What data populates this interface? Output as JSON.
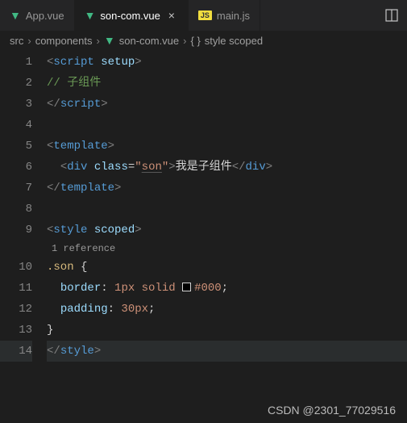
{
  "tabs": [
    {
      "icon": "vue",
      "label": "App.vue",
      "active": false
    },
    {
      "icon": "vue",
      "label": "son-com.vue",
      "active": true
    },
    {
      "icon": "js",
      "label": "main.js",
      "active": false
    }
  ],
  "breadcrumbs": {
    "seg1": "src",
    "seg2": "components",
    "seg3": "son-com.vue",
    "seg4": "style scoped",
    "brackets": "{ }"
  },
  "lines": [
    "1",
    "2",
    "3",
    "4",
    "5",
    "6",
    "7",
    "8",
    "9",
    "10",
    "11",
    "12",
    "13",
    "14"
  ],
  "code": {
    "l1": {
      "open": "<",
      "tag": "script",
      "attr": "setup",
      "close": ">"
    },
    "l2": {
      "comment": "// 子组件"
    },
    "l3": {
      "open": "</",
      "tag": "script",
      "close": ">"
    },
    "l5": {
      "open": "<",
      "tag": "template",
      "close": ">"
    },
    "l6": {
      "open": "<",
      "tag": "div",
      "attr": "class",
      "eq": "=",
      "q1": "\"",
      "str": "son",
      "q2": "\"",
      "mid": ">",
      "text": "我是子组件",
      "c1": "</",
      "ctag": "div",
      "c2": ">"
    },
    "l7": {
      "open": "</",
      "tag": "template",
      "close": ">"
    },
    "l9": {
      "open": "<",
      "tag": "style",
      "attr": "scoped",
      "close": ">"
    },
    "lens": "1 reference",
    "l10": {
      "sel": ".son",
      "brace": " {"
    },
    "l11": {
      "prop": "border",
      "colon": ":",
      "val": " 1px solid ",
      "color": "#000",
      "semi": ";"
    },
    "l12": {
      "prop": "padding",
      "colon": ":",
      "val": " 30px",
      "semi": ";"
    },
    "l13": {
      "brace": "}"
    },
    "l14": {
      "open": "</",
      "tag": "style",
      "close": ">"
    }
  },
  "watermark": "CSDN @2301_77029516"
}
